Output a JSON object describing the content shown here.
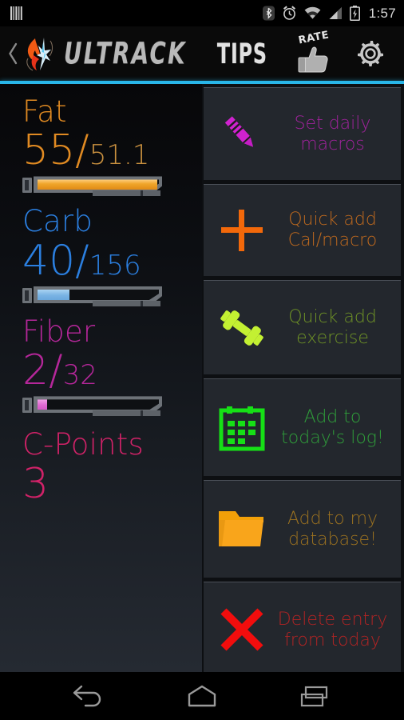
{
  "status_bar": {
    "time": "1:57",
    "icons": [
      "barcode-icon",
      "bluetooth-icon",
      "alarm-icon",
      "wifi-icon",
      "cell-signal-icon",
      "battery-charging-icon"
    ]
  },
  "app_bar": {
    "back_label": "‹",
    "brand": "ULTRACK",
    "tips_label": "TIPS",
    "rate_label": "RATE",
    "settings_icon": "gear-icon",
    "accent_color": "#29b6e8"
  },
  "macros": [
    {
      "name": "Fat",
      "current": "55",
      "separator": "/",
      "goal": "51.1",
      "color": "#e08a22",
      "goal_color": "#c9903f",
      "percent": 100,
      "bar_color": "#f0a52a",
      "has_bar": true
    },
    {
      "name": "Carb",
      "current": "40",
      "separator": "/",
      "goal": "156",
      "color": "#2b7fe0",
      "goal_color": "#2b7fe0",
      "percent": 26,
      "bar_color": "#7fb6e8",
      "has_bar": true
    },
    {
      "name": "Fiber",
      "current": "2",
      "separator": "/",
      "goal": "32",
      "color": "#b5279a",
      "goal_color": "#b5279a",
      "percent": 7,
      "bar_color": "#e06ad2",
      "has_bar": true
    },
    {
      "name": "C-Points",
      "current": "3",
      "separator": "",
      "goal": "",
      "color": "#d12268",
      "goal_color": "#d12268",
      "percent": 0,
      "bar_color": "#d12268",
      "has_bar": false
    }
  ],
  "menu": [
    {
      "icon": "pencil-icon",
      "label": "Set daily macros",
      "color": "#a0239c"
    },
    {
      "icon": "plus-icon",
      "label": "Quick add Cal/macro",
      "color": "#c06a1e"
    },
    {
      "icon": "dumbbell-icon",
      "label": "Quick add exercise",
      "color": "#6f9326"
    },
    {
      "icon": "calendar-icon",
      "label": "Add to today's log!",
      "color": "#2f9e3a"
    },
    {
      "icon": "folder-icon",
      "label": "Add to my database!",
      "color": "#9c7220"
    },
    {
      "icon": "x-icon",
      "label": "Delete entry from today",
      "color": "#b32424"
    }
  ],
  "nav_bar": {
    "back": "back-icon",
    "home": "home-icon",
    "recents": "recents-icon"
  }
}
